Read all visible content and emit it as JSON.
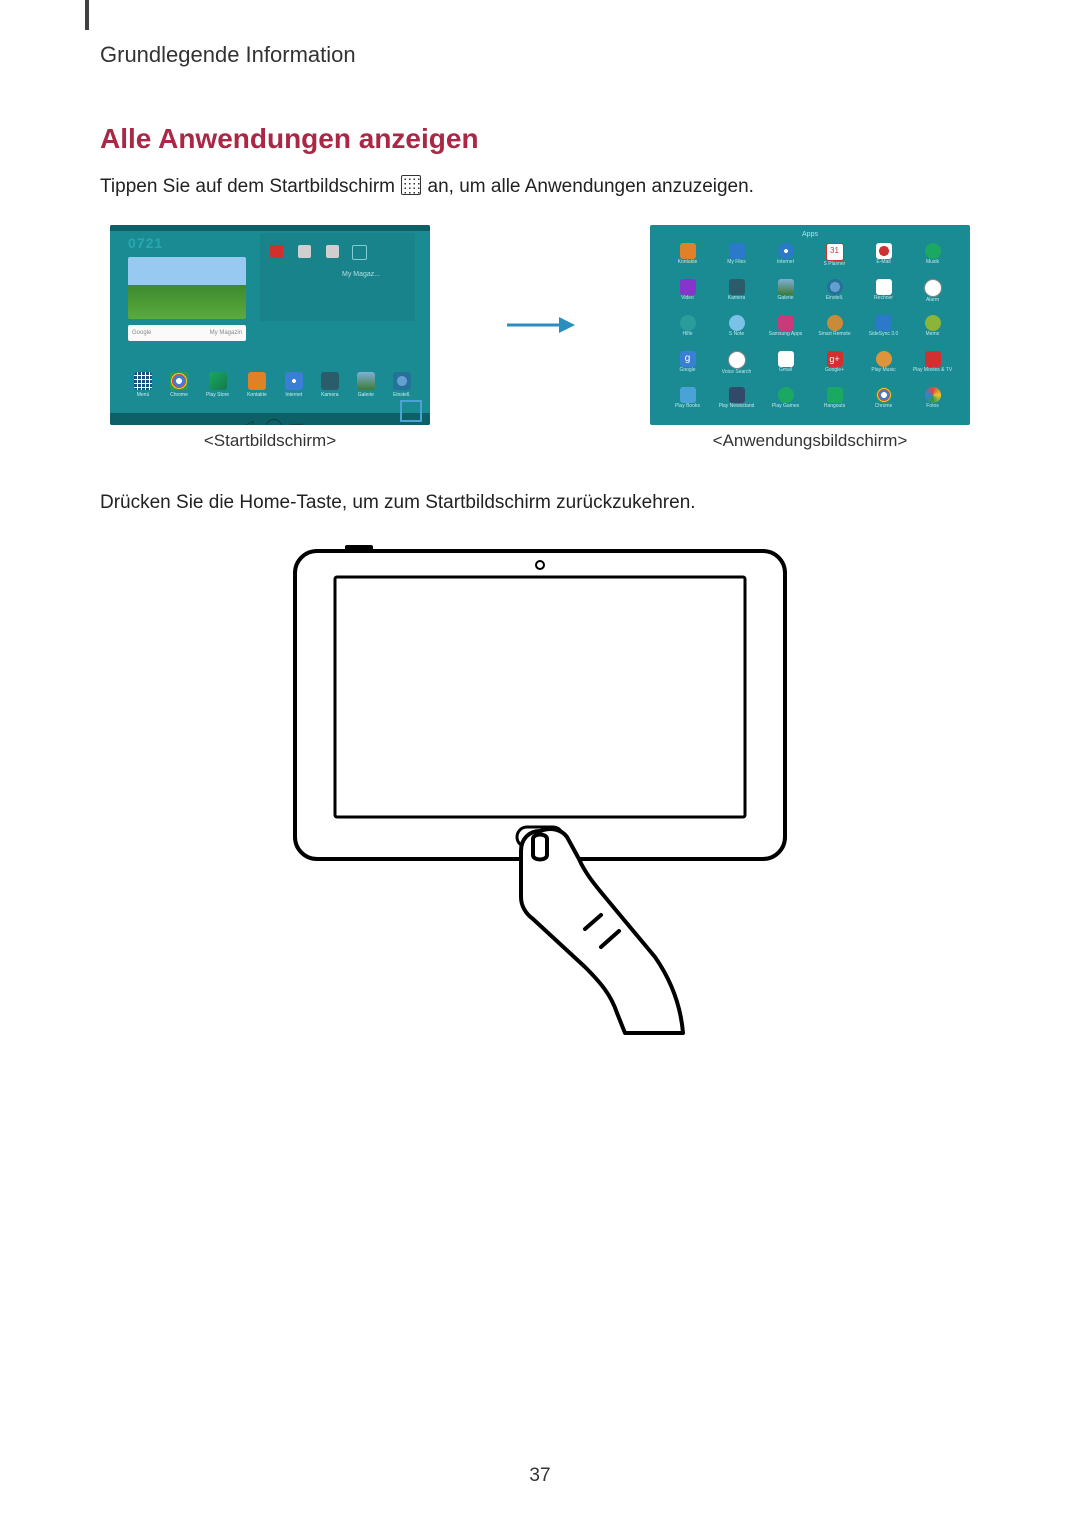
{
  "header": {
    "title": "Grundlegende Information"
  },
  "section": {
    "title": "Alle Anwendungen anzeigen",
    "intro_before_icon": "Tippen Sie auf dem Startbildschirm ",
    "intro_after_icon": " an, um alle Anwendungen anzuzeigen.",
    "caption_home": "<Startbildschirm>",
    "caption_apps": "<Anwendungsbildschirm>",
    "return_text": "Drücken Sie die Home-Taste, um zum Startbildschirm zurückzukehren."
  },
  "home_screen": {
    "clock": "0721",
    "widget_text": "My Magaz...",
    "search_left": "Google",
    "search_right": "My Magazin",
    "dock": [
      {
        "label": "Menü",
        "cls": "di-apps"
      },
      {
        "label": "Chrome",
        "cls": "di-chrome"
      },
      {
        "label": "Play Store",
        "cls": "di-play"
      },
      {
        "label": "Kontakte",
        "cls": "di-contacts"
      },
      {
        "label": "Internet",
        "cls": "di-internet"
      },
      {
        "label": "Kamera",
        "cls": "di-camera"
      },
      {
        "label": "Galerie",
        "cls": "di-gallery"
      },
      {
        "label": "Einstell.",
        "cls": "di-settings"
      }
    ]
  },
  "app_drawer": {
    "header": "Apps",
    "apps": [
      {
        "label": "Kontakte",
        "cls": "ai-contacts"
      },
      {
        "label": "My Files",
        "cls": "ai-myfiles"
      },
      {
        "label": "Internet",
        "cls": "ai-internet"
      },
      {
        "label": "S Planner",
        "cls": "ai-splanner",
        "text": "31"
      },
      {
        "label": "E-Mail",
        "cls": "ai-email"
      },
      {
        "label": "Musik",
        "cls": "ai-music"
      },
      {
        "label": "Video",
        "cls": "ai-video"
      },
      {
        "label": "Kamera",
        "cls": "ai-camera"
      },
      {
        "label": "Galerie",
        "cls": "ai-gallery"
      },
      {
        "label": "Einstell.",
        "cls": "ai-settings"
      },
      {
        "label": "Rechner",
        "cls": "ai-calculator"
      },
      {
        "label": "Alarm",
        "cls": "ai-alarm"
      },
      {
        "label": "Hilfe",
        "cls": "ai-help"
      },
      {
        "label": "S Note",
        "cls": "ai-snote"
      },
      {
        "label": "Samsung Apps",
        "cls": "ai-samsungapps"
      },
      {
        "label": "Smart Remote",
        "cls": "ai-smartremote"
      },
      {
        "label": "SideSync 3.0",
        "cls": "ai-sidesync"
      },
      {
        "label": "Memo",
        "cls": "ai-memo"
      },
      {
        "label": "Google",
        "cls": "ai-google",
        "text": "g"
      },
      {
        "label": "Voice Search",
        "cls": "ai-voicesearch"
      },
      {
        "label": "Gmail",
        "cls": "ai-gmail"
      },
      {
        "label": "Google+",
        "cls": "ai-googleplus",
        "text": "g+"
      },
      {
        "label": "Play Music",
        "cls": "ai-playmusic"
      },
      {
        "label": "Play Movies & TV",
        "cls": "ai-playmovies"
      },
      {
        "label": "Play Books",
        "cls": "ai-playbooks"
      },
      {
        "label": "Play Newsstand",
        "cls": "ai-playnewsstand"
      },
      {
        "label": "Play Games",
        "cls": "ai-playgames"
      },
      {
        "label": "Hangouts",
        "cls": "ai-hangouts"
      },
      {
        "label": "Chrome",
        "cls": "ai-chrome"
      },
      {
        "label": "Fotos",
        "cls": "ai-photos"
      }
    ]
  },
  "page_number": "37"
}
